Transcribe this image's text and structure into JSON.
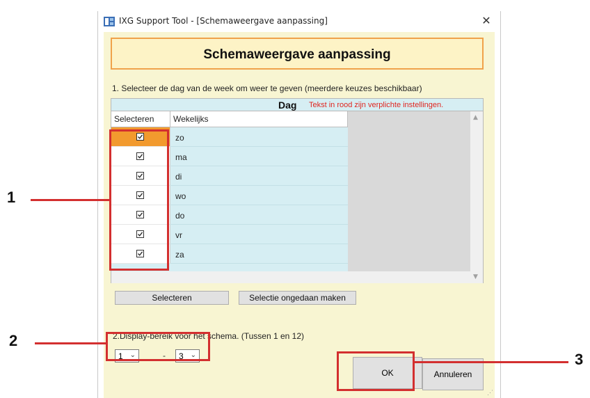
{
  "window": {
    "title": "IXG Support Tool - [Schemaweergave aanpassing]",
    "close_glyph": "✕",
    "header": "Schemaweergave aanpassing"
  },
  "section1": {
    "label": "1. Selecteer de dag van de week om weer te geven (meerdere keuzes beschikbaar)"
  },
  "grid": {
    "group_label": "Dag",
    "required_note": "Tekst in rood zijn verplichte instellingen.",
    "columns": [
      "Selecteren",
      "Wekelijks"
    ],
    "rows": [
      {
        "day": "zo",
        "checked": true,
        "active": true
      },
      {
        "day": "ma",
        "checked": true,
        "active": false
      },
      {
        "day": "di",
        "checked": true,
        "active": false
      },
      {
        "day": "wo",
        "checked": true,
        "active": false
      },
      {
        "day": "do",
        "checked": true,
        "active": false
      },
      {
        "day": "vr",
        "checked": true,
        "active": false
      },
      {
        "day": "za",
        "checked": true,
        "active": false
      }
    ]
  },
  "buttons": {
    "select": "Selecteren",
    "deselect": "Selectie ongedaan maken",
    "ok": "OK",
    "cancel": "Annuleren"
  },
  "section2": {
    "label": "2.Display-bereik voor het schema. (Tussen 1 en 12)",
    "from_value": "1",
    "to_value": "3",
    "separator": "-"
  },
  "callouts": [
    "1",
    "2",
    "3"
  ],
  "colors": {
    "accent_orange": "#f29a2e",
    "grid_blue": "#d6eef3",
    "callout_red": "#d32f2f",
    "required_red": "#e0251f",
    "client_bg": "#f8f5d2"
  }
}
